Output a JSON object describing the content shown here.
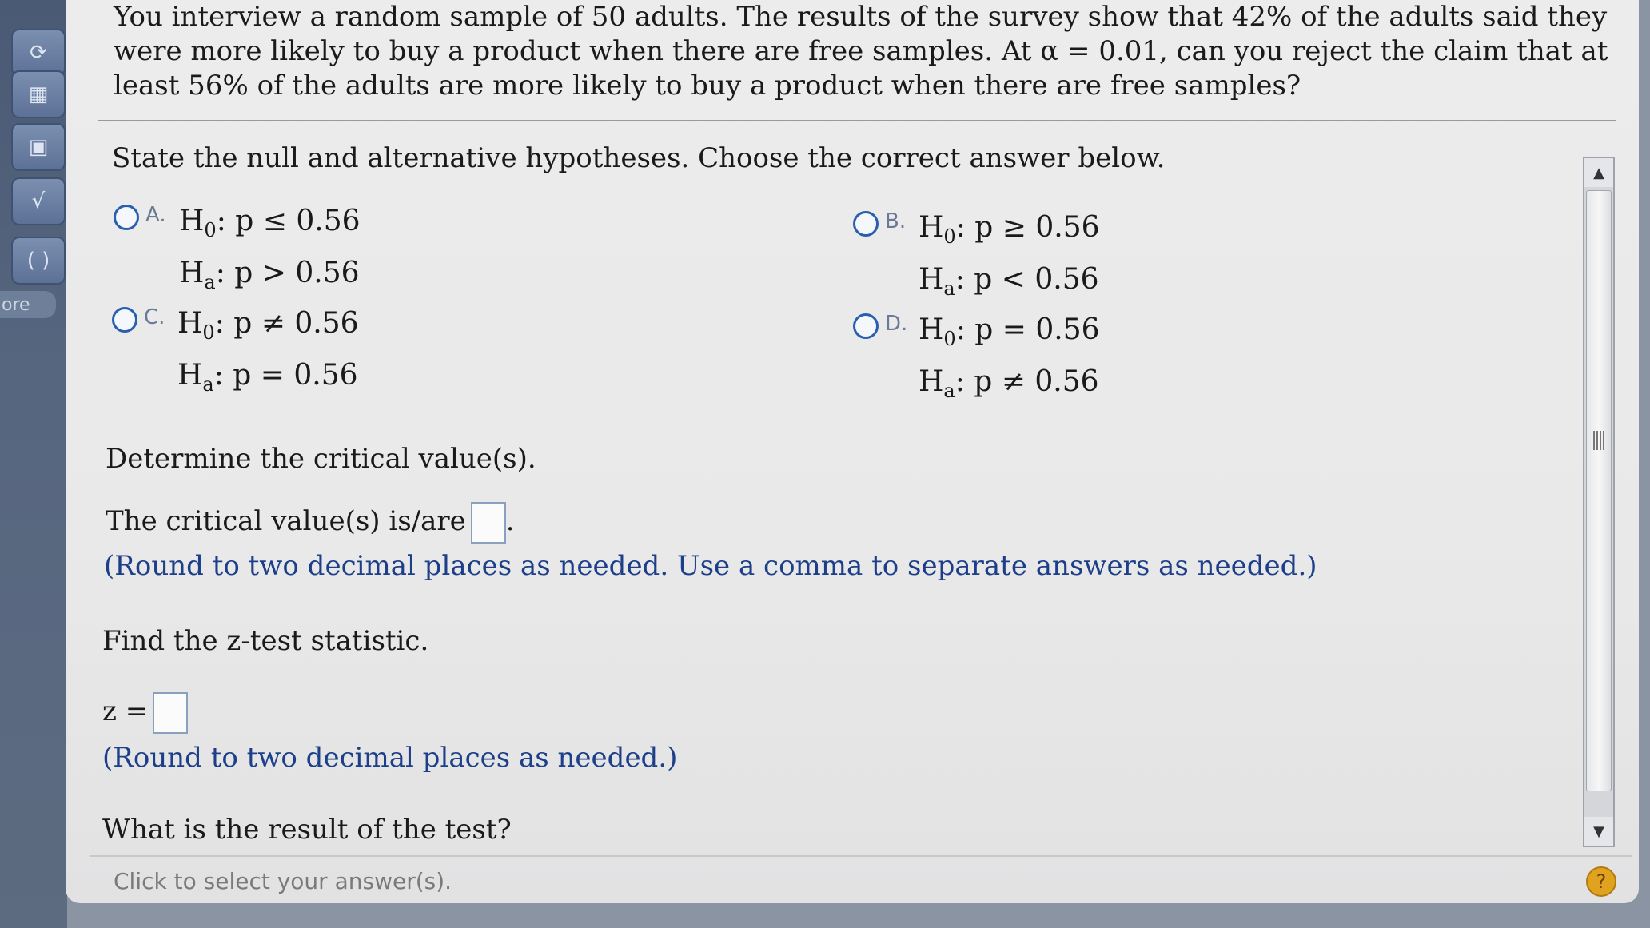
{
  "sidebar": {
    "more_label": "ore"
  },
  "question": {
    "text": "You interview a random sample of 50 adults. The results of the survey show that 42% of the adults said they were more likely to buy a product when there are free samples. At α = 0.01, can you reject the claim that at least 56% of the adults are more likely to buy a product when there are free samples?"
  },
  "part1": {
    "prompt": "State the null and alternative hypotheses. Choose the correct answer below.",
    "choices": [
      {
        "letter": "A.",
        "h0": "p ≤ 0.56",
        "ha": "p > 0.56"
      },
      {
        "letter": "B.",
        "h0": "p ≥ 0.56",
        "ha": "p < 0.56"
      },
      {
        "letter": "C.",
        "h0": "p ≠ 0.56",
        "ha": "p = 0.56"
      },
      {
        "letter": "D.",
        "h0": "p = 0.56",
        "ha": "p ≠ 0.56"
      }
    ]
  },
  "part2": {
    "prompt": "Determine the critical value(s).",
    "line": "The critical value(s) is/are",
    "note": "(Round to two decimal places as needed. Use a comma to separate answers as needed.)"
  },
  "part3": {
    "prompt": "Find the z-test statistic.",
    "label": "z =",
    "note": "(Round to two decimal places as needed.)"
  },
  "part4": {
    "prompt": "What is the result of the test?"
  },
  "footer": {
    "text": "Click to select your answer(s).",
    "help": "?"
  },
  "labels": {
    "h0": "H",
    "h0_sub": "0",
    "ha_sub": "a"
  }
}
